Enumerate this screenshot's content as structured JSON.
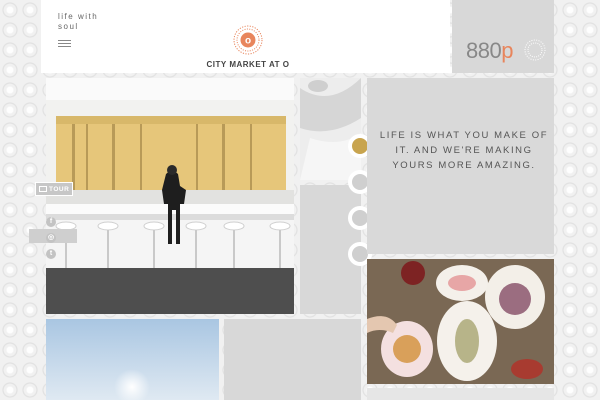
{
  "header": {
    "tagline": "life with soul",
    "brand_name": "CITY MARKET AT O",
    "logo_letter": "o"
  },
  "promo": {
    "number": "880",
    "letter": "p"
  },
  "hero_text": {
    "slogan": "LIFE IS WHAT YOU MAKE OF IT. AND WE'RE MAKING YOURS MORE AMAZING."
  },
  "side": {
    "tour_label": "TOUR",
    "social_facebook": "f",
    "social_instagram": "◎",
    "social_twitter": "t"
  },
  "colors": {
    "accent_orange": "#e8855c",
    "active_dot_gold": "#c8a44e",
    "panel_gray": "#d9d9d9"
  },
  "icons": [
    "hamburger-menu-icon",
    "sun-logo-icon",
    "tour-icon",
    "facebook-icon",
    "instagram-icon",
    "twitter-icon"
  ]
}
